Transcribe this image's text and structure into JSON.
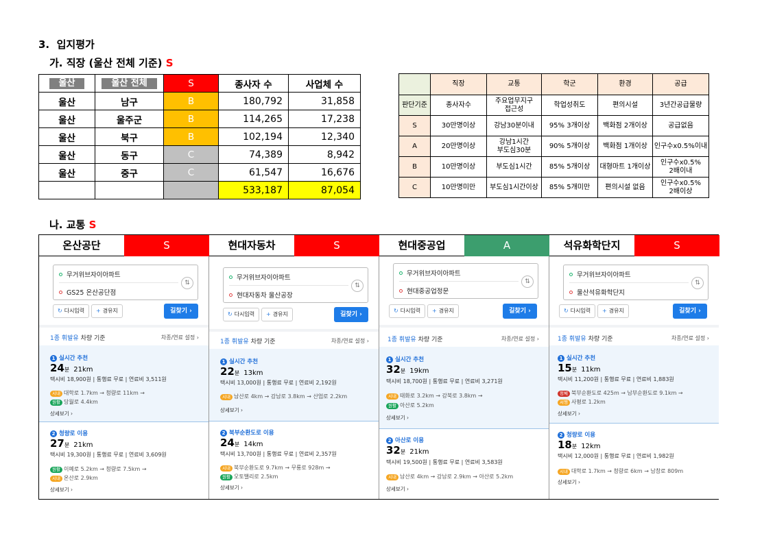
{
  "heading": {
    "num": "3.",
    "title": "입지평가"
  },
  "job": {
    "title": "가. 직장 (울산 전체 기준)",
    "grade": "S",
    "header": [
      "울산",
      "울산 전체",
      "S",
      "종사자 수",
      "사업체 수"
    ],
    "rows": [
      {
        "city": "울산",
        "district": "남구",
        "grade": "B",
        "workers": "180,792",
        "biz": "31,858"
      },
      {
        "city": "울산",
        "district": "울주군",
        "grade": "B",
        "workers": "114,265",
        "biz": "17,238"
      },
      {
        "city": "울산",
        "district": "북구",
        "grade": "B",
        "workers": "102,194",
        "biz": "12,340"
      },
      {
        "city": "울산",
        "district": "동구",
        "grade": "C",
        "workers": "74,389",
        "biz": "8,942"
      },
      {
        "city": "울산",
        "district": "중구",
        "grade": "C",
        "workers": "61,547",
        "biz": "16,676"
      }
    ],
    "total": {
      "workers": "533,187",
      "biz": "87,054"
    }
  },
  "criteria": {
    "header": [
      "",
      "직장",
      "교통",
      "학군",
      "환경",
      "공급"
    ],
    "basis": [
      "판단기준",
      "종사자수",
      "주요업무지구\n접근성",
      "학업성취도",
      "편의시설",
      "3년간공급물량"
    ],
    "rows": [
      [
        "S",
        "30만명이상",
        "강남30분이내",
        "95% 3개이상",
        "백화점 2개이상",
        "공급없음"
      ],
      [
        "A",
        "20만명이상",
        "강남1시간\n부도심30분",
        "90% 5개이상",
        "백화점 1개이상",
        "인구수x0.5%이내"
      ],
      [
        "B",
        "10만명이상",
        "부도심1시간",
        "85% 5개이상",
        "대형마트 1개이상",
        "인구수x0.5%\n2배이내"
      ],
      [
        "C",
        "10만명미만",
        "부도심1시간이상",
        "85% 5개미만",
        "편의시설 없음",
        "인구수x0.5%\n2배이상"
      ]
    ]
  },
  "transport": {
    "title": "나. 교통",
    "grade": "S",
    "panels": [
      {
        "name": "온산공단",
        "grade": "S",
        "from": "무거위브자이아파트",
        "to": "GS25 온산공단점",
        "btn_reset": "다시입력",
        "btn_via": "경유지",
        "btn_go": "길찾기",
        "option": "1종 휘발유",
        "option_suffix": "차량 기준",
        "option_right": "차종/연료 설정",
        "routes": [
          {
            "n": "1",
            "title": "실시간 추천",
            "min": "24",
            "unit": "분",
            "km": "21km",
            "fee": "택시비 18,900원 | 통행료 무료 | 연료비 3,511원",
            "road1": "대학로 1.7km → 청량로 11km →",
            "road2": "당월로 4.4km",
            "more": "상세보기"
          },
          {
            "n": "2",
            "title": "청량로 이용",
            "min": "27",
            "unit": "분",
            "km": "21km",
            "fee": "택시비 19,300원 | 통행료 무료 | 연료비 3,609원",
            "road1": "이예로 5.2km → 청량로 7.5km →",
            "road2": "온산로 2.9km",
            "more": "상세보기"
          }
        ]
      },
      {
        "name": "현대자동차",
        "grade": "S",
        "from": "무거위브자이아파트",
        "to": "현대자동차 울산공장",
        "btn_reset": "다시입력",
        "btn_via": "경유지",
        "btn_go": "길찾기",
        "option": "1종 휘발유",
        "option_suffix": "차량 기준",
        "option_right": "차종/연료 설정",
        "routes": [
          {
            "n": "1",
            "title": "실시간 추천",
            "min": "22",
            "unit": "분",
            "km": "13km",
            "fee": "택시비 13,000원 | 통행료 무료 | 연료비 2,192원",
            "road1": "남산로 4km → 강남로 3.8km → 산업로 2.2km",
            "road2": "",
            "more": "상세보기"
          },
          {
            "n": "2",
            "title": "북부순환도로 이용",
            "min": "24",
            "unit": "분",
            "km": "14km",
            "fee": "택시비 13,700원 | 통행료 무료 | 연료비 2,357원",
            "road1": "북부순환도로 9.7km → 무룡로 928m →",
            "road2": "오토밸리로 2.5km",
            "more": "상세보기"
          }
        ]
      },
      {
        "name": "현대중공업",
        "grade": "A",
        "from": "무거위브자이아파트",
        "to": "현대중공업정문",
        "btn_reset": "다시입력",
        "btn_via": "경유지",
        "btn_go": "길찾기",
        "option": "1종 휘발유",
        "option_suffix": "차량 기준",
        "option_right": "차종/연료 설정",
        "routes": [
          {
            "n": "1",
            "title": "실시간 추천",
            "min": "32",
            "unit": "분",
            "km": "19km",
            "fee": "택시비 18,700원 | 통행료 무료 | 연료비 3,271원",
            "road1": "태화로 3.2km → 강북로 3.8km →",
            "road2": "아산로 5.2km",
            "more": "상세보기"
          },
          {
            "n": "2",
            "title": "아산로 이용",
            "min": "32",
            "unit": "분",
            "km": "21km",
            "fee": "택시비 19,500원 | 통행료 무료 | 연료비 3,583원",
            "road1": "남산로 4km → 강남로 2.9km → 아산로 5.2km",
            "road2": "",
            "more": "상세보기"
          }
        ]
      },
      {
        "name": "석유화학단지",
        "grade": "S",
        "from": "무거위브자이아파트",
        "to": "울산석유화학단지",
        "btn_reset": "다시입력",
        "btn_via": "경유지",
        "btn_go": "길찾기",
        "option": "1종 휘발유",
        "option_suffix": "차량 기준",
        "option_right": "차종/연료 설정",
        "routes": [
          {
            "n": "1",
            "title": "실시간 추천",
            "min": "15",
            "unit": "분",
            "km": "11km",
            "fee": "택시비 11,200원 | 통행료 무료 | 연료비 1,883원",
            "road1": "북부순환도로 425m → 남부순환도로 9.1km →",
            "road2": "사평로 1.2km",
            "more": "상세보기"
          },
          {
            "n": "2",
            "title": "청량로 이용",
            "min": "18",
            "unit": "분",
            "km": "12km",
            "fee": "택시비 12,000원 | 통행료 무료 | 연료비 1,982원",
            "road1": "대학로 1.7km → 청량로 6km → 남창로 809m",
            "road2": "",
            "more": "상세보기"
          }
        ]
      }
    ]
  },
  "colors": {
    "red": "#ff0000",
    "orange": "#ffc000",
    "gray": "#c0c0c0",
    "yellow": "#ffff00",
    "green": "#3c9e6e",
    "blue": "#1e7ce8"
  }
}
